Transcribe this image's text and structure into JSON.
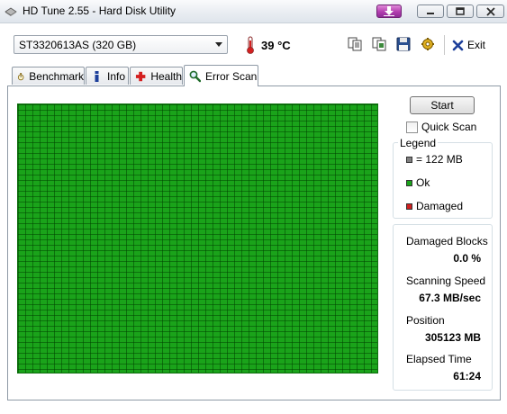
{
  "window": {
    "title": "HD Tune 2.55 - Hard Disk Utility",
    "icon": "hdtune-app-icon"
  },
  "toolbar": {
    "drive_selected": "ST3320613AS (320 GB)",
    "temperature": "39 °C",
    "exit_label": "Exit",
    "icons": [
      "copy-text-icon",
      "copy-screenshot-icon",
      "save-icon",
      "options-icon",
      "exit-icon"
    ]
  },
  "tabs": [
    {
      "label": "Benchmark",
      "icon": "stopwatch-icon"
    },
    {
      "label": "Info",
      "icon": "info-icon"
    },
    {
      "label": "Health",
      "icon": "health-cross-icon"
    },
    {
      "label": "Error Scan",
      "icon": "magnifier-icon",
      "active": true
    }
  ],
  "controls": {
    "start_label": "Start",
    "quick_scan_label": "Quick Scan",
    "quick_scan_checked": false
  },
  "legend": {
    "title": "Legend",
    "items": [
      {
        "label": "= 122 MB",
        "color": "#808080"
      },
      {
        "label": "Ok",
        "color": "#1aa31a"
      },
      {
        "label": "Damaged",
        "color": "#d02020"
      }
    ]
  },
  "stats": {
    "damaged_blocks_label": "Damaged Blocks",
    "damaged_blocks_value": "0.0 %",
    "scanning_speed_label": "Scanning Speed",
    "scanning_speed_value": "67.3 MB/sec",
    "position_label": "Position",
    "position_value": "305123 MB",
    "elapsed_label": "Elapsed Time",
    "elapsed_value": "61:24"
  },
  "scan_map": {
    "block_status": "ok",
    "color": "#1aa31a"
  }
}
